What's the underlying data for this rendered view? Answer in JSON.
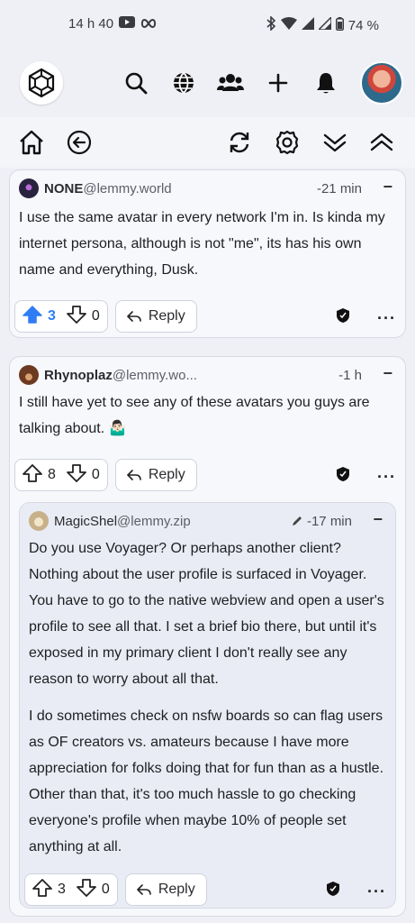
{
  "status": {
    "time": "14 h 40",
    "battery": "74 %"
  },
  "comments": [
    {
      "user": "NONE",
      "instance": "@lemmy.world",
      "time": "-21 min",
      "body": [
        "I use the same avatar in every network I'm in. Is kinda my internet persona, although is not \"me\", its has his own name and everything, Dusk."
      ],
      "upvotes": "3",
      "downvotes": "0",
      "upvoted": true,
      "reply_label": "Reply"
    },
    {
      "user": "Rhynoplaz",
      "instance": "@lemmy.wo...",
      "time": "-1 h",
      "body": [
        "I still have yet to see any of these avatars you guys are talking about. 🤷🏻‍♂️"
      ],
      "upvotes": "8",
      "downvotes": "0",
      "upvoted": false,
      "reply_label": "Reply"
    },
    {
      "user": "MagicShel",
      "instance": "@lemmy.zip",
      "time": "-17 min",
      "edited": true,
      "body": [
        "Do you use Voyager? Or perhaps another client? Nothing about the user profile is surfaced in Voyager. You have to go to the native webview and open a user's profile to see all that. I set a brief bio there, but until it's exposed in my primary client I don't really see any reason to worry about all that.",
        "I do sometimes check on nsfw boards so can flag users as OF creators vs. amateurs because I have more appreciation for folks doing that for fun than as a hustle. Other than that, it's too much hassle to go checking everyone's profile when maybe 10% of people set anything at all."
      ],
      "upvotes": "3",
      "downvotes": "0",
      "upvoted": false,
      "reply_label": "Reply"
    }
  ],
  "colors": {
    "upvote_active": "#2f7df5",
    "background": "#eef0f6"
  }
}
